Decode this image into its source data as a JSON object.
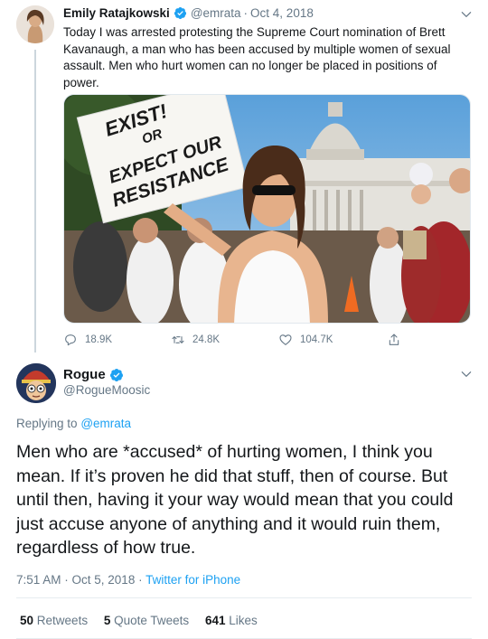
{
  "tweet": {
    "author_name": "Emily Ratajkowski",
    "handle": "@emrata",
    "separator": "·",
    "date": "Oct 4, 2018",
    "text": "Today I was arrested protesting the Supreme Court nomination of Brett Kavanaugh, a man who has been accused by multiple women of sexual assault. Men who hurt women can no longer be placed in positions of power.",
    "photo": {
      "sign_text_1": "EXIST!",
      "sign_text_2": "OR",
      "sign_text_3": "EXPECT OUR",
      "sign_text_4": "RESISTANCE"
    },
    "actions": {
      "replies": "18.9K",
      "retweets": "24.8K",
      "likes": "104.7K"
    }
  },
  "reply": {
    "author_name": "Rogue",
    "handle": "@RogueMoosic",
    "replying_prefix": "Replying to",
    "replying_to": "@emrata",
    "text": "Men who are *accused* of hurting women, I think you mean. If it’s proven he did that stuff, then of course. But until then, having it your way would mean that you could just accuse anyone of anything and it would ruin them, regardless of how true.",
    "time_date": "7:51 AM · Oct 5, 2018 ·",
    "source": "Twitter for iPhone",
    "stats": {
      "retweets_count": "50",
      "retweets_label": "Retweets",
      "quotes_count": "5",
      "quotes_label": "Quote Tweets",
      "likes_count": "641",
      "likes_label": "Likes"
    }
  },
  "colors": {
    "accent": "#1da1f2",
    "secondary_text": "#657786",
    "primary_text": "#14171a",
    "divider": "#e6ecf0"
  },
  "icons": [
    "verified-badge-icon",
    "chevron-down-icon",
    "reply-icon",
    "retweet-icon",
    "like-icon",
    "share-icon"
  ]
}
